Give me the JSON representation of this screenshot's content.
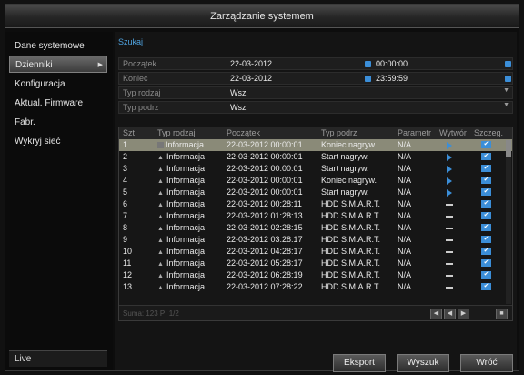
{
  "window": {
    "title": "Zarządzanie systemem"
  },
  "sidebar": {
    "items": [
      {
        "label": "Dane systemowe"
      },
      {
        "label": "Dzienniki"
      },
      {
        "label": "Konfiguracja"
      },
      {
        "label": "Aktual. Firmware"
      },
      {
        "label": "Fabr."
      },
      {
        "label": "Wykryj sieć"
      }
    ],
    "live_label": "Live"
  },
  "main": {
    "tab_label": "Szukaj",
    "form": {
      "start": {
        "label": "Początek",
        "date": "22-03-2012",
        "time": "00:00:00"
      },
      "end": {
        "label": "Koniec",
        "date": "22-03-2012",
        "time": "23:59:59"
      },
      "major_type": {
        "label": "Typ rodzaj",
        "value": "Wsz"
      },
      "minor_type": {
        "label": "Typ podrz",
        "value": "Wsz"
      }
    },
    "table": {
      "headers": [
        "Szt",
        "Typ rodzaj",
        "Początek",
        "Typ podrz",
        "Parametr",
        "Wytwór",
        "Szczeg."
      ],
      "rows": [
        {
          "no": "1",
          "type": "Informacja",
          "time": "22-03-2012 00:00:01",
          "minor": "Koniec nagryw.",
          "param": "N/A",
          "play": true
        },
        {
          "no": "2",
          "type": "Informacja",
          "time": "22-03-2012 00:00:01",
          "minor": "Start nagryw.",
          "param": "N/A",
          "play": true
        },
        {
          "no": "3",
          "type": "Informacja",
          "time": "22-03-2012 00:00:01",
          "minor": "Start nagryw.",
          "param": "N/A",
          "play": true
        },
        {
          "no": "4",
          "type": "Informacja",
          "time": "22-03-2012 00:00:01",
          "minor": "Koniec nagryw.",
          "param": "N/A",
          "play": true
        },
        {
          "no": "5",
          "type": "Informacja",
          "time": "22-03-2012 00:00:01",
          "minor": "Start nagryw.",
          "param": "N/A",
          "play": true
        },
        {
          "no": "6",
          "type": "Informacja",
          "time": "22-03-2012 00:28:11",
          "minor": "HDD S.M.A.R.T.",
          "param": "N/A",
          "play": false
        },
        {
          "no": "7",
          "type": "Informacja",
          "time": "22-03-2012 01:28:13",
          "minor": "HDD S.M.A.R.T.",
          "param": "N/A",
          "play": false
        },
        {
          "no": "8",
          "type": "Informacja",
          "time": "22-03-2012 02:28:15",
          "minor": "HDD S.M.A.R.T.",
          "param": "N/A",
          "play": false
        },
        {
          "no": "9",
          "type": "Informacja",
          "time": "22-03-2012 03:28:17",
          "minor": "HDD S.M.A.R.T.",
          "param": "N/A",
          "play": false
        },
        {
          "no": "10",
          "type": "Informacja",
          "time": "22-03-2012 04:28:17",
          "minor": "HDD S.M.A.R.T.",
          "param": "N/A",
          "play": false
        },
        {
          "no": "11",
          "type": "Informacja",
          "time": "22-03-2012 05:28:17",
          "minor": "HDD S.M.A.R.T.",
          "param": "N/A",
          "play": false
        },
        {
          "no": "12",
          "type": "Informacja",
          "time": "22-03-2012 06:28:19",
          "minor": "HDD S.M.A.R.T.",
          "param": "N/A",
          "play": false
        },
        {
          "no": "13",
          "type": "Informacja",
          "time": "22-03-2012 07:28:22",
          "minor": "HDD S.M.A.R.T.",
          "param": "N/A",
          "play": false
        }
      ],
      "footer_text": "Suma: 123 P: 1/2"
    },
    "buttons": {
      "export": "Eksport",
      "search": "Wyszuk",
      "back": "Wróć"
    }
  },
  "colors": {
    "accent": "#3b8ed8",
    "selected_row": "#8a8a78"
  }
}
